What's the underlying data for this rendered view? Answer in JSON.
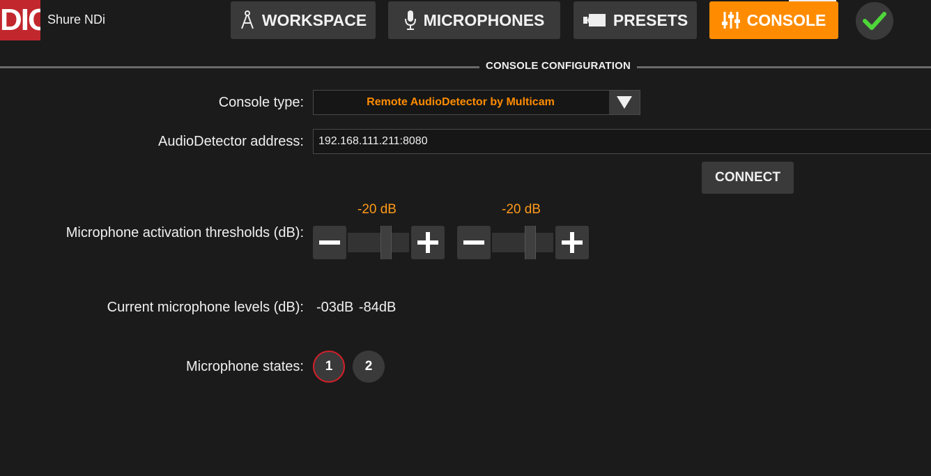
{
  "header": {
    "logo_text": "DIO",
    "app_name": "Shure NDi",
    "tabs": [
      {
        "label": "WORKSPACE",
        "icon": "compass-icon"
      },
      {
        "label": "MICROPHONES",
        "icon": "microphone-icon"
      },
      {
        "label": "PRESETS",
        "icon": "camera-icon"
      },
      {
        "label": "CONSOLE",
        "icon": "sliders-icon",
        "active": true
      }
    ],
    "status_icon": "check-icon",
    "status_color": "#4fd63a"
  },
  "section": {
    "title": "CONSOLE CONFIGURATION"
  },
  "form": {
    "console_type_label": "Console type:",
    "console_type_value": "Remote AudioDetector by Multicam",
    "address_label": "AudioDetector address:",
    "address_value": "192.168.111.211:8080",
    "connect_label": "CONNECT",
    "thresholds_label": "Microphone activation thresholds (dB):",
    "thresholds": [
      {
        "value_label": "-20 dB",
        "level": 0.65
      },
      {
        "value_label": "-20 dB",
        "level": 0.65
      }
    ],
    "levels_label": "Current microphone levels (dB):",
    "levels_value": "-03dB  -84dB",
    "states_label": "Microphone states:",
    "states": [
      {
        "label": "1",
        "active": true
      },
      {
        "label": "2",
        "active": false
      }
    ]
  },
  "colors": {
    "accent": "#ff8c00",
    "background": "#1b1b1b",
    "button": "#3a3a3a",
    "active_ring": "#d0202a"
  }
}
